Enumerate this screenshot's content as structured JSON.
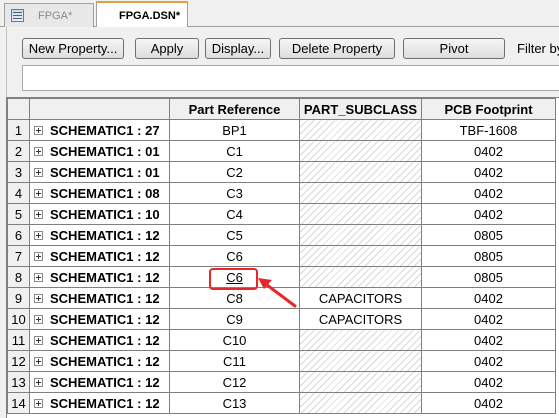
{
  "tabs": [
    {
      "label": "FPGA*",
      "active": false
    },
    {
      "label": "FPGA.DSN*",
      "active": true
    }
  ],
  "toolbar": {
    "new_property": "New Property...",
    "apply": "Apply",
    "display": "Display...",
    "delete_property": "Delete Property",
    "pivot": "Pivot",
    "filter_label": "Filter by"
  },
  "grid": {
    "columns": [
      "",
      "",
      "Part Reference",
      "PART_SUBCLASS",
      "PCB Footprint"
    ],
    "rows": [
      {
        "num": "1",
        "name": "SCHEMATIC1 : 27",
        "ref": "BP1",
        "subclass": "",
        "footprint": "TBF-1608"
      },
      {
        "num": "2",
        "name": "SCHEMATIC1 : 01",
        "ref": "C1",
        "subclass": "",
        "footprint": "0402"
      },
      {
        "num": "3",
        "name": "SCHEMATIC1 : 01",
        "ref": "C2",
        "subclass": "",
        "footprint": "0402"
      },
      {
        "num": "4",
        "name": "SCHEMATIC1 : 08",
        "ref": "C3",
        "subclass": "",
        "footprint": "0402"
      },
      {
        "num": "5",
        "name": "SCHEMATIC1 : 10",
        "ref": "C4",
        "subclass": "",
        "footprint": "0402"
      },
      {
        "num": "6",
        "name": "SCHEMATIC1 : 12",
        "ref": "C5",
        "subclass": "",
        "footprint": "0805"
      },
      {
        "num": "7",
        "name": "SCHEMATIC1 : 12",
        "ref": "C6",
        "subclass": "",
        "footprint": "0805"
      },
      {
        "num": "8",
        "name": "SCHEMATIC1 : 12",
        "ref": "C6",
        "subclass": "",
        "footprint": "0805"
      },
      {
        "num": "9",
        "name": "SCHEMATIC1 : 12",
        "ref": "C8",
        "subclass": "CAPACITORS",
        "footprint": "0402"
      },
      {
        "num": "10",
        "name": "SCHEMATIC1 : 12",
        "ref": "C9",
        "subclass": "CAPACITORS",
        "footprint": "0402"
      },
      {
        "num": "11",
        "name": "SCHEMATIC1 : 12",
        "ref": "C10",
        "subclass": "",
        "footprint": "0402"
      },
      {
        "num": "12",
        "name": "SCHEMATIC1 : 12",
        "ref": "C11",
        "subclass": "",
        "footprint": "0402"
      },
      {
        "num": "13",
        "name": "SCHEMATIC1 : 12",
        "ref": "C12",
        "subclass": "",
        "footprint": "0402"
      },
      {
        "num": "14",
        "name": "SCHEMATIC1 : 12",
        "ref": "C13",
        "subclass": "",
        "footprint": "0402"
      }
    ]
  },
  "annotation": {
    "highlight_color": "#e8262a"
  }
}
